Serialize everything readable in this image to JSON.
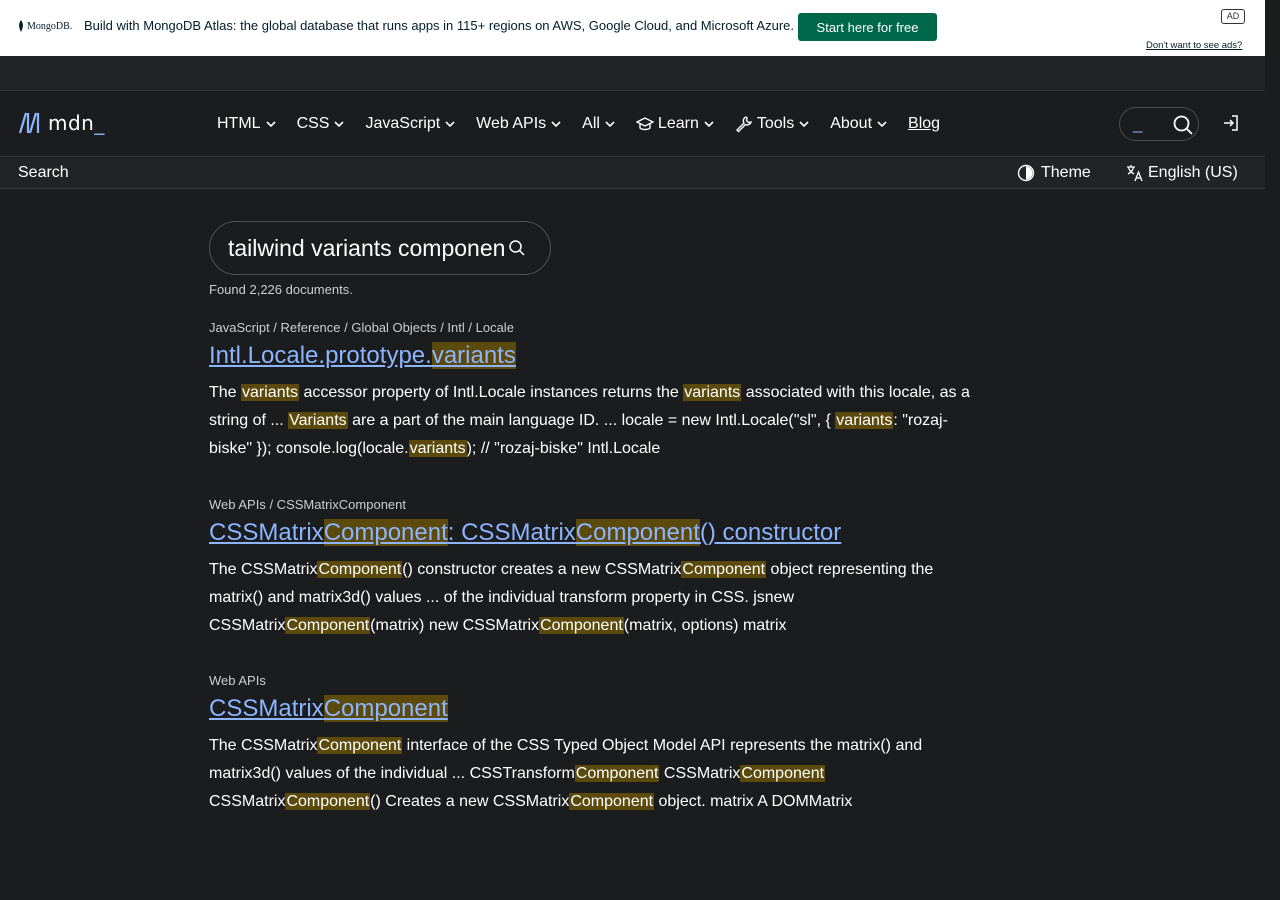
{
  "ad": {
    "brand": "MongoDB.",
    "message": "Build with MongoDB Atlas: the global database that runs apps in 115+ regions on AWS, Google Cloud, and Microsoft Azure.",
    "cta": "Start here for free",
    "badge": "AD",
    "optout": "Don't want to see ads?",
    "accent": "#00684a"
  },
  "header": {
    "logo_text": "mdn",
    "nav": [
      {
        "label": "HTML"
      },
      {
        "label": "CSS"
      },
      {
        "label": "JavaScript"
      },
      {
        "label": "Web APIs"
      },
      {
        "label": "All"
      },
      {
        "label": "Learn",
        "icon": "graduation-cap-icon"
      },
      {
        "label": "Tools",
        "icon": "wrench-icon"
      },
      {
        "label": "About"
      }
    ],
    "blog": "Blog",
    "search_cursor": "_",
    "link_color": "#8cb4ff"
  },
  "subbar": {
    "search": "Search",
    "theme": "Theme",
    "language": "English (US)"
  },
  "search": {
    "query": "tailwind variants component",
    "found": "Found 2,226 documents."
  },
  "results": [
    {
      "breadcrumb": "JavaScript / Reference / Global Objects / Intl / Locale",
      "title": [
        {
          "t": "Intl.Locale.prototype."
        },
        {
          "t": "variants",
          "h": true
        }
      ],
      "snippet": [
        {
          "t": "The "
        },
        {
          "t": "variants",
          "h": true
        },
        {
          "t": " accessor property of Intl.Locale instances returns the "
        },
        {
          "t": "variants",
          "h": true
        },
        {
          "t": " associated with this locale, as a string of ... "
        },
        {
          "t": "Variants",
          "h": true
        },
        {
          "t": " are a part of the main language ID. ... locale = new Intl.Locale(\"sl\", { "
        },
        {
          "t": "variants",
          "h": true
        },
        {
          "t": ": \"rozaj-biske\" }); console.log(locale."
        },
        {
          "t": "variants",
          "h": true
        },
        {
          "t": "); // \"rozaj-biske\" Intl.Locale"
        }
      ]
    },
    {
      "breadcrumb": "Web APIs / CSSMatrixComponent",
      "title": [
        {
          "t": "CSSMatrix"
        },
        {
          "t": "Component",
          "h": true
        },
        {
          "t": ": CSSMatrix"
        },
        {
          "t": "Component",
          "h": true
        },
        {
          "t": "() constructor"
        }
      ],
      "snippet": [
        {
          "t": "The CSSMatrix"
        },
        {
          "t": "Component",
          "h": true
        },
        {
          "t": "() constructor creates a new CSSMatrix"
        },
        {
          "t": "Component",
          "h": true
        },
        {
          "t": " object representing the matrix() and matrix3d() values ... of the individual transform property in CSS. jsnew CSSMatrix"
        },
        {
          "t": "Component",
          "h": true
        },
        {
          "t": "(matrix) new CSSMatrix"
        },
        {
          "t": "Component",
          "h": true
        },
        {
          "t": "(matrix, options) matrix"
        }
      ]
    },
    {
      "breadcrumb": "Web APIs",
      "title": [
        {
          "t": "CSSMatrix"
        },
        {
          "t": "Component",
          "h": true
        }
      ],
      "snippet": [
        {
          "t": "The CSSMatrix"
        },
        {
          "t": "Component",
          "h": true
        },
        {
          "t": " interface of the CSS Typed Object Model API represents the matrix() and matrix3d() values of the individual ... CSSTransform"
        },
        {
          "t": "Component",
          "h": true
        },
        {
          "t": " CSSMatrix"
        },
        {
          "t": "Component",
          "h": true
        },
        {
          "t": " CSSMatrix"
        },
        {
          "t": "Component",
          "h": true
        },
        {
          "t": "() Creates a new CSSMatrix"
        },
        {
          "t": "Component",
          "h": true
        },
        {
          "t": " object. matrix A DOMMatrix"
        }
      ]
    }
  ]
}
